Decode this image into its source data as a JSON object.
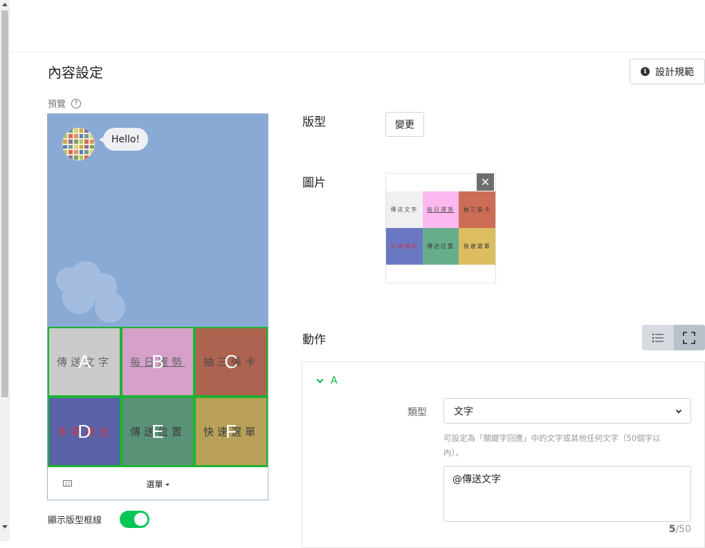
{
  "page": {
    "title": "內容設定",
    "design_button": "設計規範",
    "preview_label": "預覽",
    "toggle_label": "顯示版型框線",
    "toggle_on": true
  },
  "preview": {
    "bubble_text": "Hello!",
    "menu_bar_label": "選單",
    "cells": [
      {
        "letter": "A",
        "text": "傳送文字",
        "bg": "#cbcbcb",
        "color": "#666666"
      },
      {
        "letter": "B",
        "text": "每日運勢",
        "bg": "#d6a0c9",
        "color": "#666666"
      },
      {
        "letter": "C",
        "text": "抽三張卡",
        "bg": "#ad6350",
        "color": "#4a4a4a"
      },
      {
        "letter": "D",
        "text": "多項傳送",
        "bg": "#5a62a8",
        "color": "#c0394b"
      },
      {
        "letter": "E",
        "text": "傳送位置",
        "bg": "#5a9277",
        "color": "#3c3c3c"
      },
      {
        "letter": "F",
        "text": "快速選單",
        "bg": "#b8a058",
        "color": "#3c3c3c"
      }
    ]
  },
  "layout_section": {
    "label": "版型",
    "change_button": "變更"
  },
  "image_section": {
    "label": "圖片",
    "thumbnail_cells": [
      {
        "text": "傳送文字",
        "bg": "#f0f0f2",
        "color": "#555555"
      },
      {
        "text": "每日運勢",
        "bg": "#fbb9ef",
        "color": "#555555"
      },
      {
        "text": "抽三張卡",
        "bg": "#cc6d55",
        "color": "#3a3a3a"
      },
      {
        "text": "多項傳送",
        "bg": "#6a78c4",
        "color": "#d0344b"
      },
      {
        "text": "傳送位置",
        "bg": "#66ad8b",
        "color": "#3a3a3a"
      },
      {
        "text": "快速選單",
        "bg": "#dcbd62",
        "color": "#3a3a3a"
      }
    ]
  },
  "action_section": {
    "label": "動作",
    "accordion_title": "A",
    "type_label": "類型",
    "type_value": "文字",
    "hint": "可設定為「關鍵字回應」中的文字或其他任何文字（50個字以內）。",
    "text_value": "@傳送文字",
    "counter_current": "5",
    "counter_max": "/50"
  },
  "colors": {
    "accent_green": "#06c755",
    "preview_bg": "#8aaad6",
    "grid_border": "#1db332"
  }
}
